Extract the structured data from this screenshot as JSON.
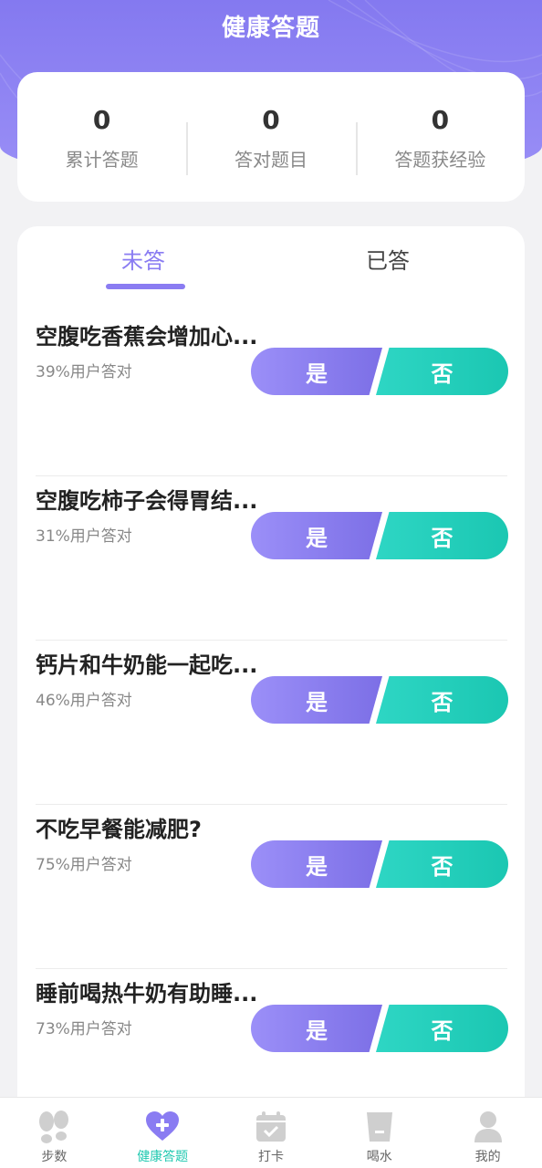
{
  "header": {
    "title": "健康答题"
  },
  "stats": [
    {
      "value": "0",
      "label": "累计答题"
    },
    {
      "value": "0",
      "label": "答对题目"
    },
    {
      "value": "0",
      "label": "答题获经验"
    }
  ],
  "tabs": [
    {
      "label": "未答",
      "active": true
    },
    {
      "label": "已答",
      "active": false
    }
  ],
  "questions": [
    {
      "title": "空腹吃香蕉会增加心...",
      "rate": "39%用户答对",
      "yes": "是",
      "no": "否"
    },
    {
      "title": "空腹吃柿子会得胃结...",
      "rate": "31%用户答对",
      "yes": "是",
      "no": "否"
    },
    {
      "title": "钙片和牛奶能一起吃...",
      "rate": "46%用户答对",
      "yes": "是",
      "no": "否"
    },
    {
      "title": "不吃早餐能减肥?",
      "rate": "75%用户答对",
      "yes": "是",
      "no": "否"
    },
    {
      "title": "睡前喝热牛奶有助睡...",
      "rate": "73%用户答对",
      "yes": "是",
      "no": "否"
    }
  ],
  "nav": [
    {
      "label": "步数",
      "icon": "footprints-icon"
    },
    {
      "label": "健康答题",
      "icon": "heart-plus-icon",
      "active": true
    },
    {
      "label": "打卡",
      "icon": "calendar-check-icon"
    },
    {
      "label": "喝水",
      "icon": "water-cup-icon"
    },
    {
      "label": "我的",
      "icon": "user-icon"
    }
  ],
  "colors": {
    "primary": "#8a7cf2",
    "accent": "#1fc8b0",
    "nav_inactive": "#c8c8c8"
  }
}
